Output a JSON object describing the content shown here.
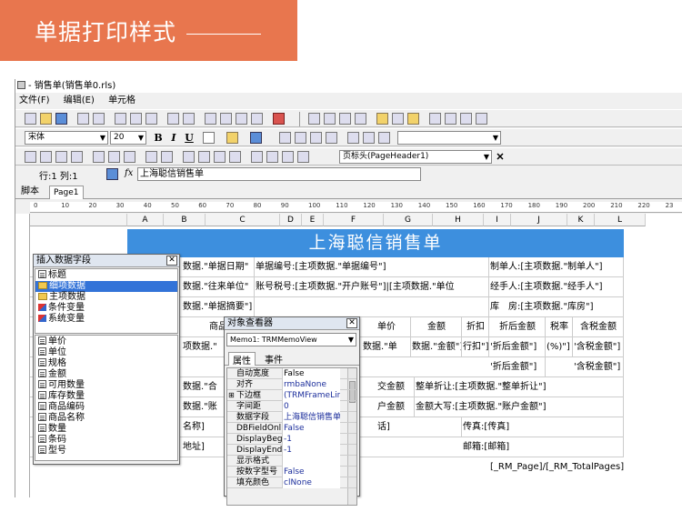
{
  "banner": {
    "title": "单据打印样式"
  },
  "window": {
    "title": "- 销售单(销售单0.rls)",
    "menu": [
      "文件(F)",
      "编辑(E)",
      "单元格"
    ],
    "font_name": "宋体",
    "font_size": "20",
    "bold": "B",
    "italic": "I",
    "underline": "U",
    "band_select": "页标头(PageHeader1)",
    "cell_position": "行:1 列:1",
    "fx_label": "fx",
    "formula_value": "上海聪信销售单",
    "tabs": [
      "脚本",
      "Page1"
    ]
  },
  "ruler": [
    "0",
    "10",
    "20",
    "30",
    "40",
    "50",
    "60",
    "70",
    "80",
    "90",
    "100",
    "110",
    "120",
    "130",
    "140",
    "150",
    "160",
    "170",
    "180",
    "190",
    "200",
    "210",
    "220",
    "23"
  ],
  "columns": [
    "A",
    "B",
    "C",
    "D",
    "E",
    "F",
    "G",
    "H",
    "I",
    "J",
    "K",
    "L"
  ],
  "report": {
    "title": "上海聪信销售单",
    "rows": [
      [
        {
          "t": "数据.\"单据日期\""
        },
        {
          "t": "单据编号:[主项数据.\"单据编号\"]"
        },
        {
          "t": "制单人:[主项数据.\"制单人\"]"
        }
      ],
      [
        {
          "t": "数据.\"往来单位\""
        },
        {
          "t": "账号税号:[主项数据.\"开户账号\"]|[主项数据.\"单位"
        },
        {
          "t": "经手人:[主项数据.\"经手人\"]"
        }
      ],
      [
        {
          "t": "数据.\"单据摘要\"]"
        },
        {
          "t": ""
        },
        {
          "t": "库　房:[主项数据.\"库房\"]"
        }
      ],
      [
        {
          "t": "商品"
        },
        {
          "t": "单价"
        },
        {
          "t": "金额"
        },
        {
          "t": "折扣"
        },
        {
          "t": "折后金额"
        },
        {
          "t": "税率"
        },
        {
          "t": "含税金额"
        }
      ],
      [
        {
          "t": "项数据.\""
        },
        {
          "t": "数据.\"单"
        },
        {
          "t": "数据.\"金额\"]"
        },
        {
          "t": "行扣\"]"
        },
        {
          "t": "'折后金额\"]"
        },
        {
          "t": "(%)\"]"
        },
        {
          "t": "'含税金额\"]"
        }
      ],
      [
        {
          "t": "'折后金额\"]"
        },
        {
          "t": "'含税金额\"]"
        }
      ],
      [
        {
          "t": "数据.\"合"
        },
        {
          "t": "交金额"
        },
        {
          "t": "整单折让:[主项数据.\"整单折让\"]"
        }
      ],
      [
        {
          "t": "数据.\"账"
        },
        {
          "t": "户金额"
        },
        {
          "t": "金额大写:[主项数据.\"账户金额\"]"
        }
      ],
      [
        {
          "t": "名称]"
        },
        {
          "t": "话]"
        },
        {
          "t": "传真:[传真]"
        }
      ],
      [
        {
          "t": "地址]"
        },
        {
          "t": "邮箱:[邮箱]"
        }
      ],
      [
        {
          "t": "[_RM_Page]/[_RM_TotalPages]"
        }
      ]
    ]
  },
  "insert_panel": {
    "title": "插入数据字段",
    "tree": [
      "标题",
      "细项数据",
      "主项数据",
      "条件变量",
      "系统变量"
    ],
    "fields": [
      "单价",
      "单位",
      "规格",
      "金额",
      "可用数量",
      "库存数量",
      "商品编码",
      "商品名称",
      "数量",
      "条码",
      "型号"
    ]
  },
  "inspector": {
    "title": "对象查看器",
    "object": "Memo1: TRMMemoView",
    "tabs": [
      "属性",
      "事件"
    ],
    "props": [
      {
        "name": "自动宽度",
        "value": "False"
      },
      {
        "name": "对齐",
        "value": "rmbaNone"
      },
      {
        "name": "下边框",
        "value": "(TRMFrameLine"
      },
      {
        "name": "字间距",
        "value": "0"
      },
      {
        "name": "数据字段",
        "value": "上海聪信销售单"
      },
      {
        "name": "DBFieldOnl",
        "value": "False"
      },
      {
        "name": "DisplayBeg",
        "value": "-1"
      },
      {
        "name": "DisplayEnd",
        "value": "-1"
      },
      {
        "name": "显示格式",
        "value": ""
      },
      {
        "name": "按数字型号",
        "value": "False"
      },
      {
        "name": "填充颜色",
        "value": "clNone"
      }
    ]
  },
  "colors": {
    "banner": "#e8764e",
    "title_band": "#3d8fde"
  }
}
